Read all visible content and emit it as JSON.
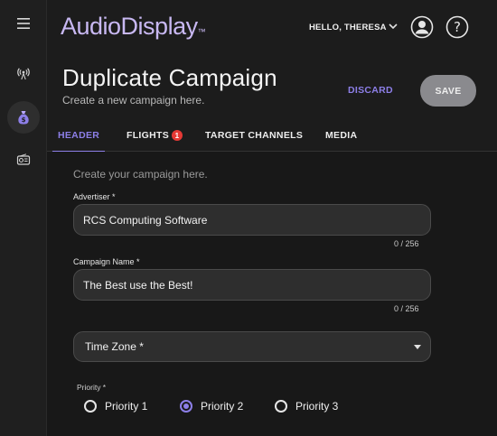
{
  "app": {
    "logo_text": "AudioDisplay",
    "logo_mark": "™",
    "greeting": "HELLO, THERESA",
    "accent_color": "#8d7fe8"
  },
  "rail": {
    "items": [
      {
        "icon": "menu-icon"
      },
      {
        "icon": "broadcast-icon"
      },
      {
        "icon": "money-bag-icon",
        "active": true
      },
      {
        "icon": "radio-device-icon"
      }
    ]
  },
  "page": {
    "title": "Duplicate Campaign",
    "subtitle": "Create a new campaign here.",
    "discard_label": "DISCARD",
    "save_label": "SAVE"
  },
  "tabs": [
    {
      "label": "HEADER",
      "active": true
    },
    {
      "label": "FLIGHTS",
      "badge": "1"
    },
    {
      "label": "TARGET CHANNELS"
    },
    {
      "label": "MEDIA"
    }
  ],
  "form": {
    "intro": "Create your campaign here.",
    "advertiser": {
      "label": "Advertiser *",
      "value": "RCS Computing Software",
      "counter": "0 / 256"
    },
    "campaign_name": {
      "label": "Campaign Name *",
      "value": "The Best use the Best!",
      "counter": "0 / 256"
    },
    "time_zone": {
      "label": "Time Zone *"
    },
    "priority": {
      "label": "Priority *",
      "options": [
        {
          "label": "Priority 1",
          "checked": false
        },
        {
          "label": "Priority 2",
          "checked": true
        },
        {
          "label": "Priority 3",
          "checked": false
        }
      ]
    }
  }
}
